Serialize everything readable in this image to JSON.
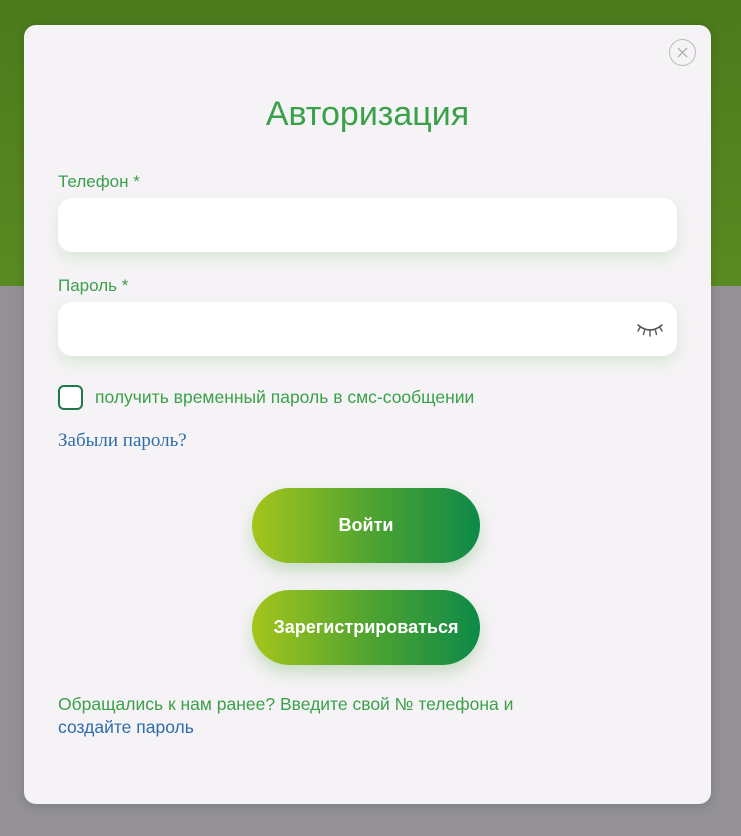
{
  "dialog": {
    "title": "Авторизация",
    "phone": {
      "label": "Телефон *",
      "value": "",
      "placeholder": ""
    },
    "password": {
      "label": "Пароль *",
      "value": "",
      "placeholder": ""
    },
    "sms_option": {
      "label": "получить временный пароль в смс-сообщении",
      "checked": false
    },
    "forgot_link": "Забыли пароль?",
    "login_button": "Войти",
    "register_button": "Зарегистрироваться",
    "footer": {
      "text": "Обращались к нам ранее? Введите свой № телефона и",
      "link": "создайте пароль"
    }
  },
  "icons": {
    "close": "close-icon",
    "password_toggle": "eye-closed-icon"
  },
  "colors": {
    "accent_green": "#3aa14a",
    "link_blue": "#2e6dab",
    "header_green": "#4b7a1c",
    "overlay_gray": "#939194",
    "modal_bg": "#f6f3f6",
    "button_gradient_start": "#a5c51b",
    "button_gradient_end": "#0d8a48"
  }
}
